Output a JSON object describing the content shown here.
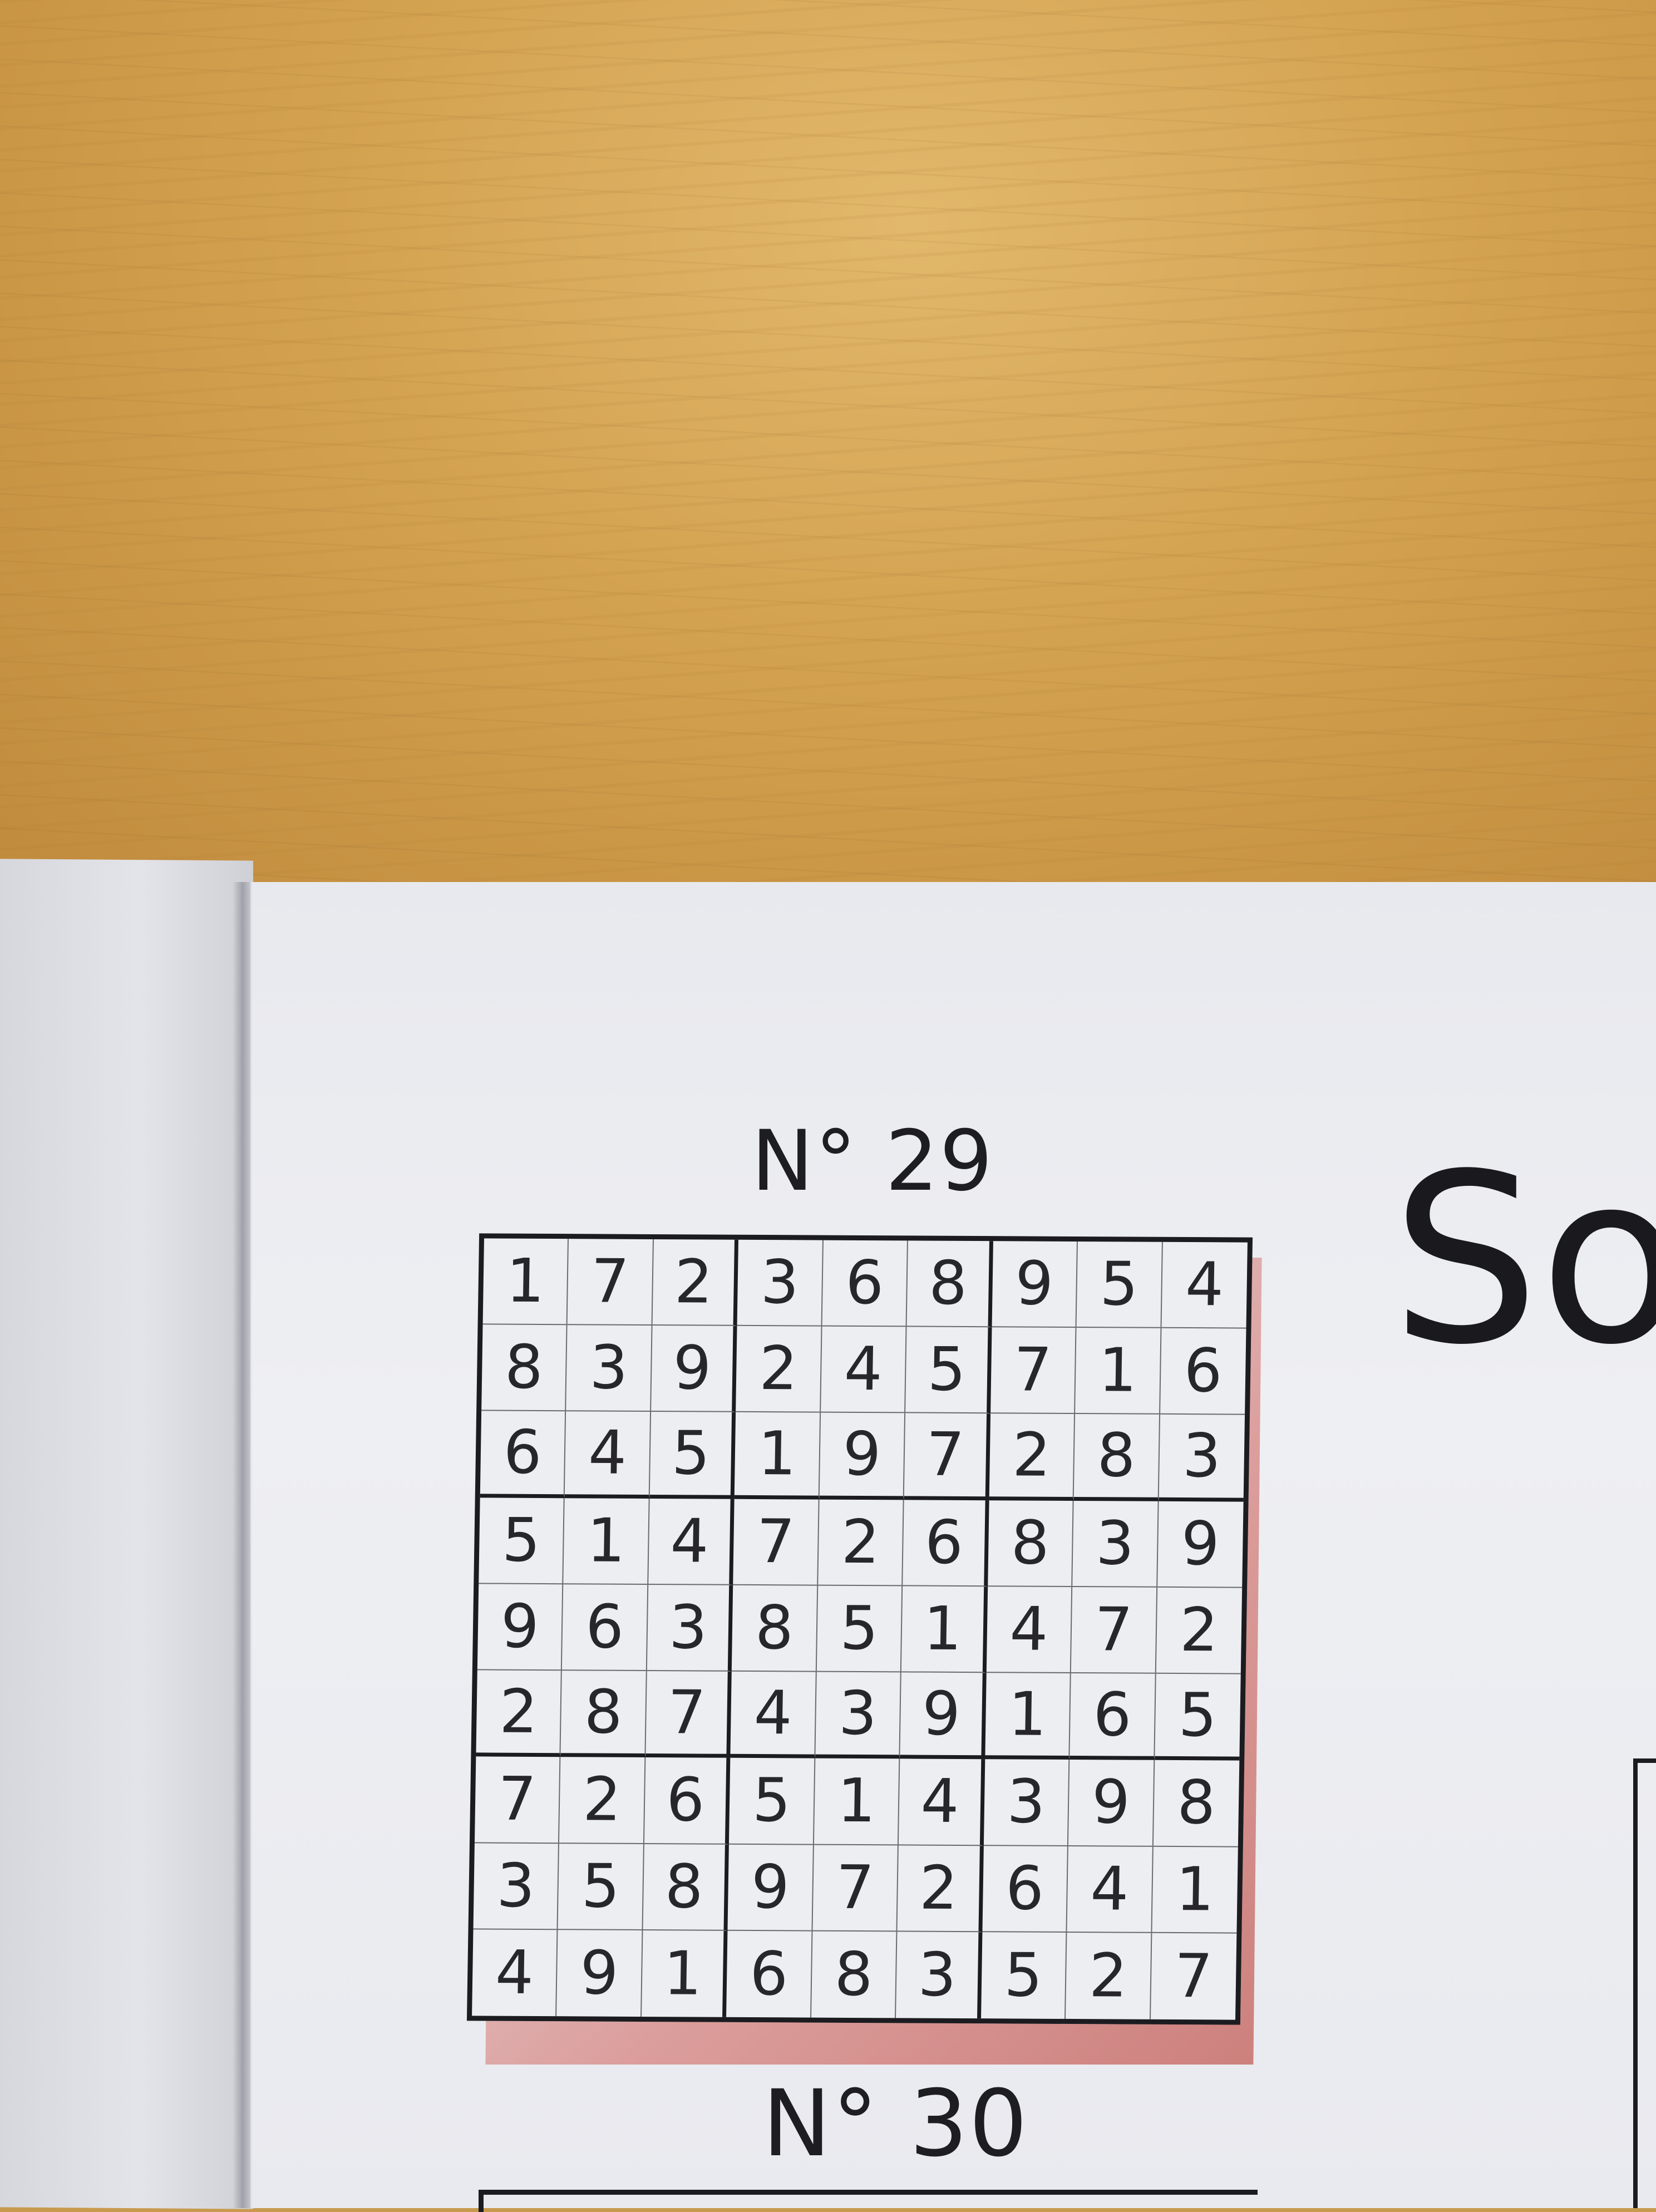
{
  "puzzle_29": {
    "title": "N° 29",
    "rows": [
      [
        "1",
        "7",
        "2",
        "3",
        "6",
        "8",
        "9",
        "5",
        "4"
      ],
      [
        "8",
        "3",
        "9",
        "2",
        "4",
        "5",
        "7",
        "1",
        "6"
      ],
      [
        "6",
        "4",
        "5",
        "1",
        "9",
        "7",
        "2",
        "8",
        "3"
      ],
      [
        "5",
        "1",
        "4",
        "7",
        "2",
        "6",
        "8",
        "3",
        "9"
      ],
      [
        "9",
        "6",
        "3",
        "8",
        "5",
        "1",
        "4",
        "7",
        "2"
      ],
      [
        "2",
        "8",
        "7",
        "4",
        "3",
        "9",
        "1",
        "6",
        "5"
      ],
      [
        "7",
        "2",
        "6",
        "5",
        "1",
        "4",
        "3",
        "9",
        "8"
      ],
      [
        "3",
        "5",
        "8",
        "9",
        "7",
        "2",
        "6",
        "4",
        "1"
      ],
      [
        "4",
        "9",
        "1",
        "6",
        "8",
        "3",
        "5",
        "2",
        "7"
      ]
    ]
  },
  "puzzle_30": {
    "title": "N° 30"
  },
  "side_heading": "So",
  "colors": {
    "table_wood": "#c89a4e",
    "page": "#eceef2",
    "ink": "#1c1c20",
    "grid_shadow": "#d6847f"
  }
}
